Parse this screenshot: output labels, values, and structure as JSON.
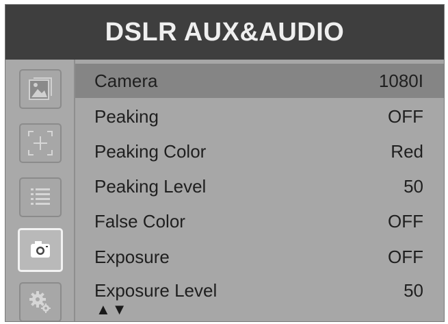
{
  "title": "DSLR AUX&AUDIO",
  "sidebar": {
    "items": [
      {
        "icon": "picture-icon"
      },
      {
        "icon": "crosshair-frame-icon"
      },
      {
        "icon": "list-icon"
      },
      {
        "icon": "camera-icon",
        "active": true
      },
      {
        "icon": "gear-icon"
      }
    ]
  },
  "menu": {
    "rows": [
      {
        "label": "Camera",
        "value": "1080I",
        "selected": true
      },
      {
        "label": "Peaking",
        "value": "OFF"
      },
      {
        "label": "Peaking Color",
        "value": "Red"
      },
      {
        "label": "Peaking Level",
        "value": "50"
      },
      {
        "label": "False Color",
        "value": "OFF"
      },
      {
        "label": "Exposure",
        "value": "OFF"
      },
      {
        "label": "Exposure Level",
        "value": "50"
      }
    ],
    "scroll_arrows": "▲▼"
  },
  "colors": {
    "title_bg": "#3e3e3e",
    "panel_bg": "#a7a7a7",
    "selected_row": "#858585",
    "active_border": "#f2f2f2"
  }
}
